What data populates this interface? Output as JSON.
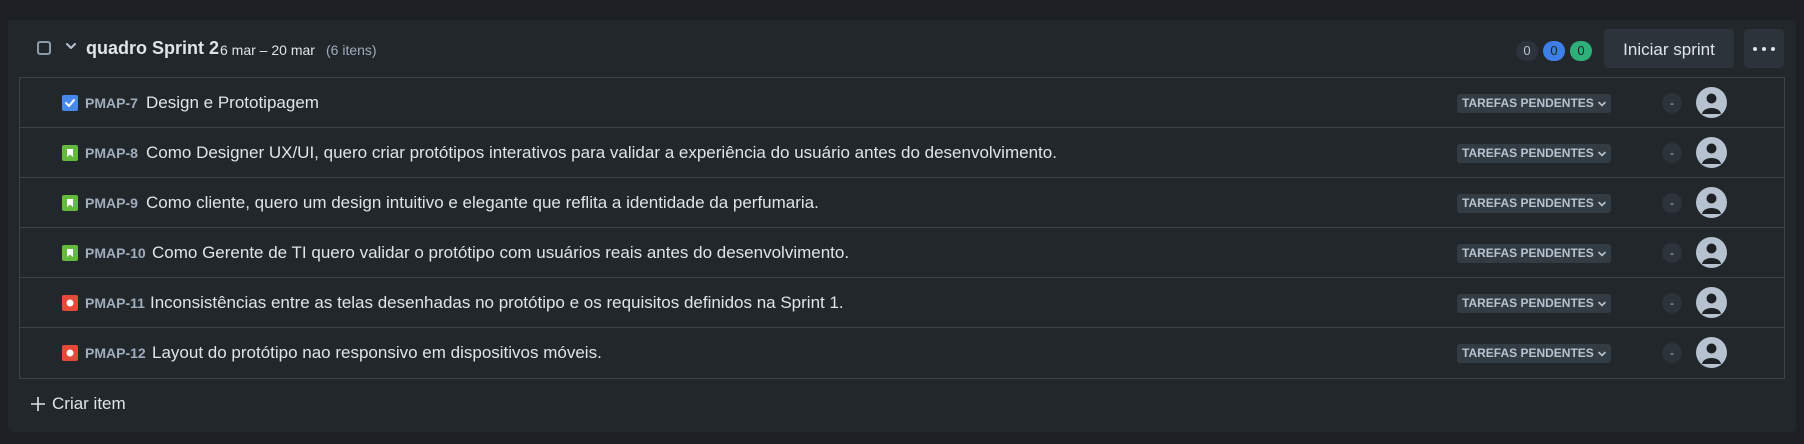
{
  "sprint": {
    "title": "quadro Sprint 2",
    "dates": "6 mar – 20 mar",
    "count": "(6 itens)",
    "badges": [
      "0",
      "0",
      "0"
    ],
    "start_label": "Iniciar sprint"
  },
  "items": [
    {
      "key": "PMAP-7",
      "summary": "Design e Prototipagem",
      "type": "task",
      "status": "TAREFAS PENDENTES",
      "estimate": "-"
    },
    {
      "key": "PMAP-8",
      "summary": "Como Designer UX/UI, quero criar protótipos interativos para validar a experiência do usuário antes do desenvolvimento.",
      "type": "story",
      "status": "TAREFAS PENDENTES",
      "estimate": "-"
    },
    {
      "key": "PMAP-9",
      "summary": "Como cliente, quero um design intuitivo e elegante que reflita a identidade da perfumaria.",
      "type": "story",
      "status": "TAREFAS PENDENTES",
      "estimate": "-"
    },
    {
      "key": "PMAP-10",
      "summary": "Como Gerente de TI quero validar o protótipo com usuários reais antes do desenvolvimento.",
      "type": "story",
      "status": "TAREFAS PENDENTES",
      "estimate": "-"
    },
    {
      "key": "PMAP-11",
      "summary": "Inconsistências entre as telas desenhadas no protótipo e os requisitos definidos na Sprint 1.",
      "type": "bug",
      "status": "TAREFAS PENDENTES",
      "estimate": "-"
    },
    {
      "key": "PMAP-12",
      "summary": "Layout do protótipo nao responsivo em dispositivos móveis.",
      "type": "bug",
      "status": "TAREFAS PENDENTES",
      "estimate": "-"
    }
  ],
  "create_label": "Criar item",
  "colors": {
    "task": "#4688ec",
    "story": "#63ba3c",
    "bug": "#e5493a",
    "badge_blue": "#3d7ee8",
    "badge_green": "#2fb07a"
  }
}
